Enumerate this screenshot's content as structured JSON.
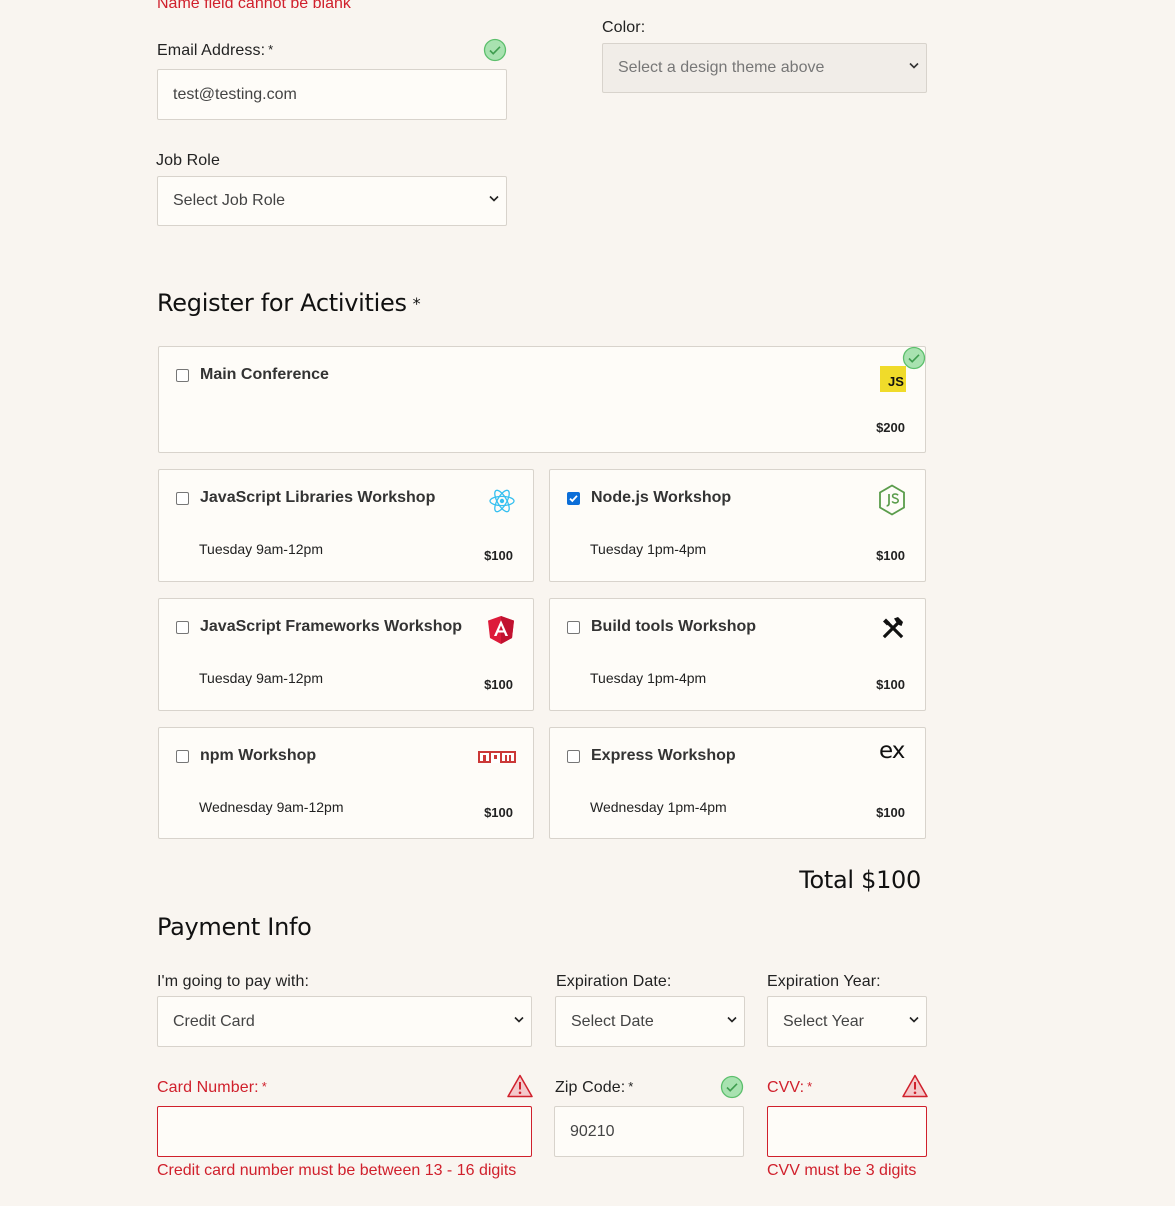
{
  "errors": {
    "name": "Name field cannot be blank",
    "card": "Credit card number must be between 13 - 16 digits",
    "cvv": "CVV must be 3 digits"
  },
  "email": {
    "label": "Email Address:",
    "required_mark": "*",
    "value": "test@testing.com"
  },
  "job_role": {
    "label": "Job Role",
    "selected": "Select Job Role"
  },
  "color": {
    "label": "Color:",
    "selected": "Select a design theme above"
  },
  "activities": {
    "heading": "Register for Activities",
    "required_mark": "*",
    "items": [
      {
        "name": "Main Conference",
        "time": "",
        "price": "$200",
        "checked": false,
        "icon": "javascript-logo-icon"
      },
      {
        "name": "JavaScript Libraries Workshop",
        "time": "Tuesday 9am-12pm",
        "price": "$100",
        "checked": false,
        "icon": "react-logo-icon"
      },
      {
        "name": "Node.js Workshop",
        "time": "Tuesday 1pm-4pm",
        "price": "$100",
        "checked": true,
        "icon": "nodejs-logo-icon"
      },
      {
        "name": "JavaScript Frameworks Workshop",
        "time": "Tuesday 9am-12pm",
        "price": "$100",
        "checked": false,
        "icon": "angular-logo-icon"
      },
      {
        "name": "Build tools Workshop",
        "time": "Tuesday 1pm-4pm",
        "price": "$100",
        "checked": false,
        "icon": "build-tools-icon"
      },
      {
        "name": "npm Workshop",
        "time": "Wednesday 9am-12pm",
        "price": "$100",
        "checked": false,
        "icon": "npm-logo-icon"
      },
      {
        "name": "Express Workshop",
        "time": "Wednesday 1pm-4pm",
        "price": "$100",
        "checked": false,
        "icon": "express-logo-icon"
      }
    ],
    "total": "Total $100"
  },
  "payment": {
    "heading": "Payment Info",
    "method_label": "I'm going to pay with:",
    "method_selected": "Credit Card",
    "exp_date_label": "Expiration Date:",
    "exp_date_selected": "Select Date",
    "exp_year_label": "Expiration Year:",
    "exp_year_selected": "Select Year",
    "card_label": "Card Number:",
    "card_value": "",
    "zip_label": "Zip Code:",
    "zip_value": "90210",
    "cvv_label": "CVV:",
    "cvv_value": "",
    "required_mark": "*"
  },
  "logos": {
    "javascript": "JS",
    "express": "ex"
  },
  "colors": {
    "error": "#d0202c",
    "valid": "#7fcf8a",
    "checkbox_checked": "#0b6ed8",
    "background": "#f9f5f0"
  }
}
